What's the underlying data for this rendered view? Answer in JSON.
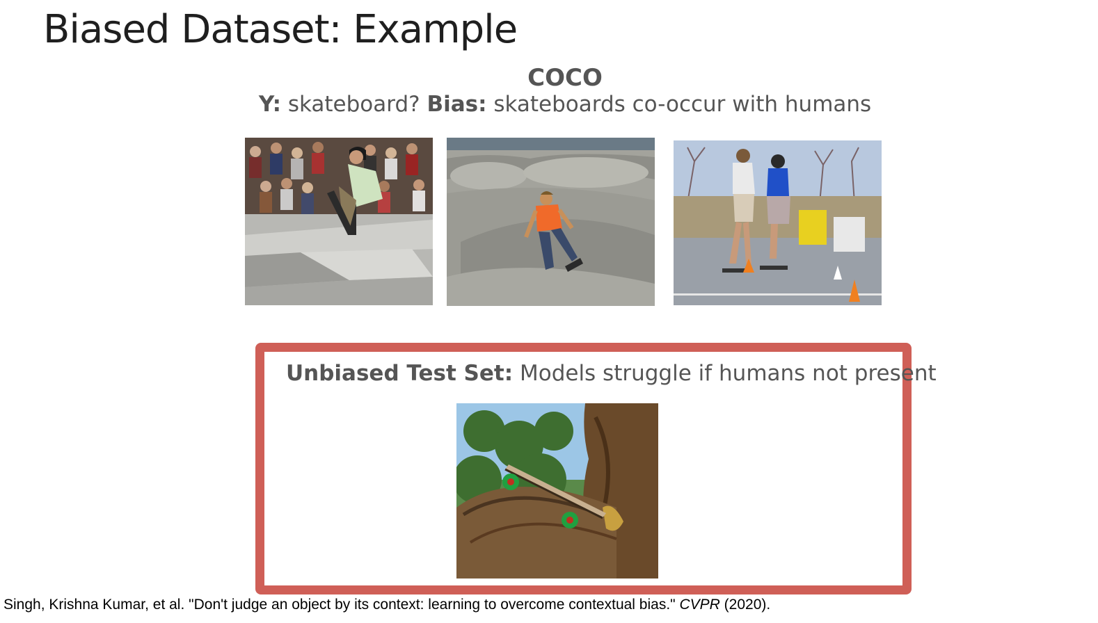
{
  "slide": {
    "title": "Biased Dataset: Example",
    "dataset_name": "COCO",
    "subtitle": {
      "y_label": "Y:",
      "y_text": " skateboard? ",
      "bias_label": "Bias:",
      "bias_text": " skateboards co-occur with humans"
    }
  },
  "images": [
    {
      "name": "skateboarder-jump-crowd"
    },
    {
      "name": "skateboarder-bowl-park"
    },
    {
      "name": "skateboarders-cones-street"
    }
  ],
  "test_set": {
    "label": "Unbiased Test Set:",
    "text": " Models struggle if humans not present",
    "image": {
      "name": "skateboard-on-tree"
    }
  },
  "citation": {
    "text": "Singh, Krishna Kumar, et al. \"Don't judge an object by its context: learning to overcome contextual bias.\" ",
    "venue": "CVPR",
    "year": " (2020)."
  },
  "colors": {
    "box_border": "#cf5f57",
    "title": "#1f1f1f",
    "subtitle": "#555555"
  }
}
